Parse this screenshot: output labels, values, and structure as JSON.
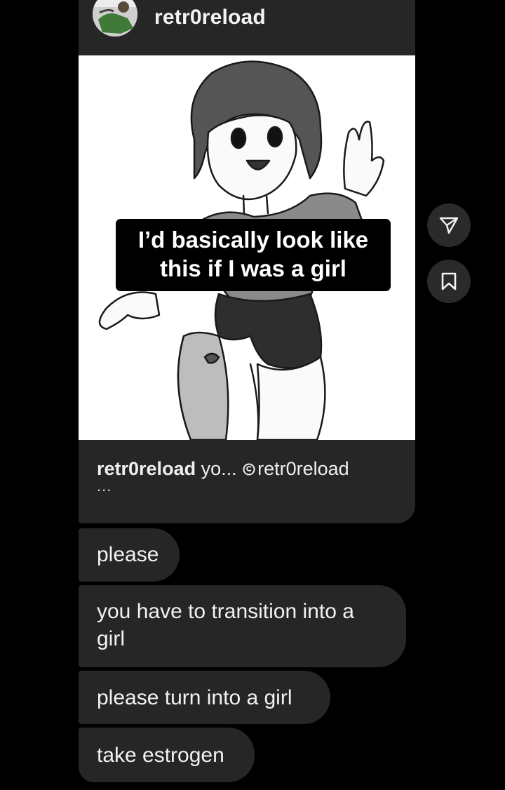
{
  "shared_post": {
    "username": "retr0reload",
    "overlay_caption": [
      "I’d basically look like",
      "this if I was a girl"
    ],
    "caption": {
      "username": "retr0reload",
      "text": " yo... ",
      "handle": "retr0reload",
      "ellipsis": "..."
    },
    "image_icon": "grayscale-anime-girl-illustration"
  },
  "side_actions": [
    {
      "name": "share",
      "icon": "paper-plane-icon"
    },
    {
      "name": "save",
      "icon": "bookmark-icon"
    }
  ],
  "messages": [
    {
      "text": "please"
    },
    {
      "text": "you have to transition into a girl"
    },
    {
      "text": "please turn into a girl"
    },
    {
      "text": "take estrogen"
    }
  ],
  "colors": {
    "background": "#000000",
    "bubble": "#262626",
    "text": "#f2f2f2",
    "button": "#2a2a2a"
  }
}
